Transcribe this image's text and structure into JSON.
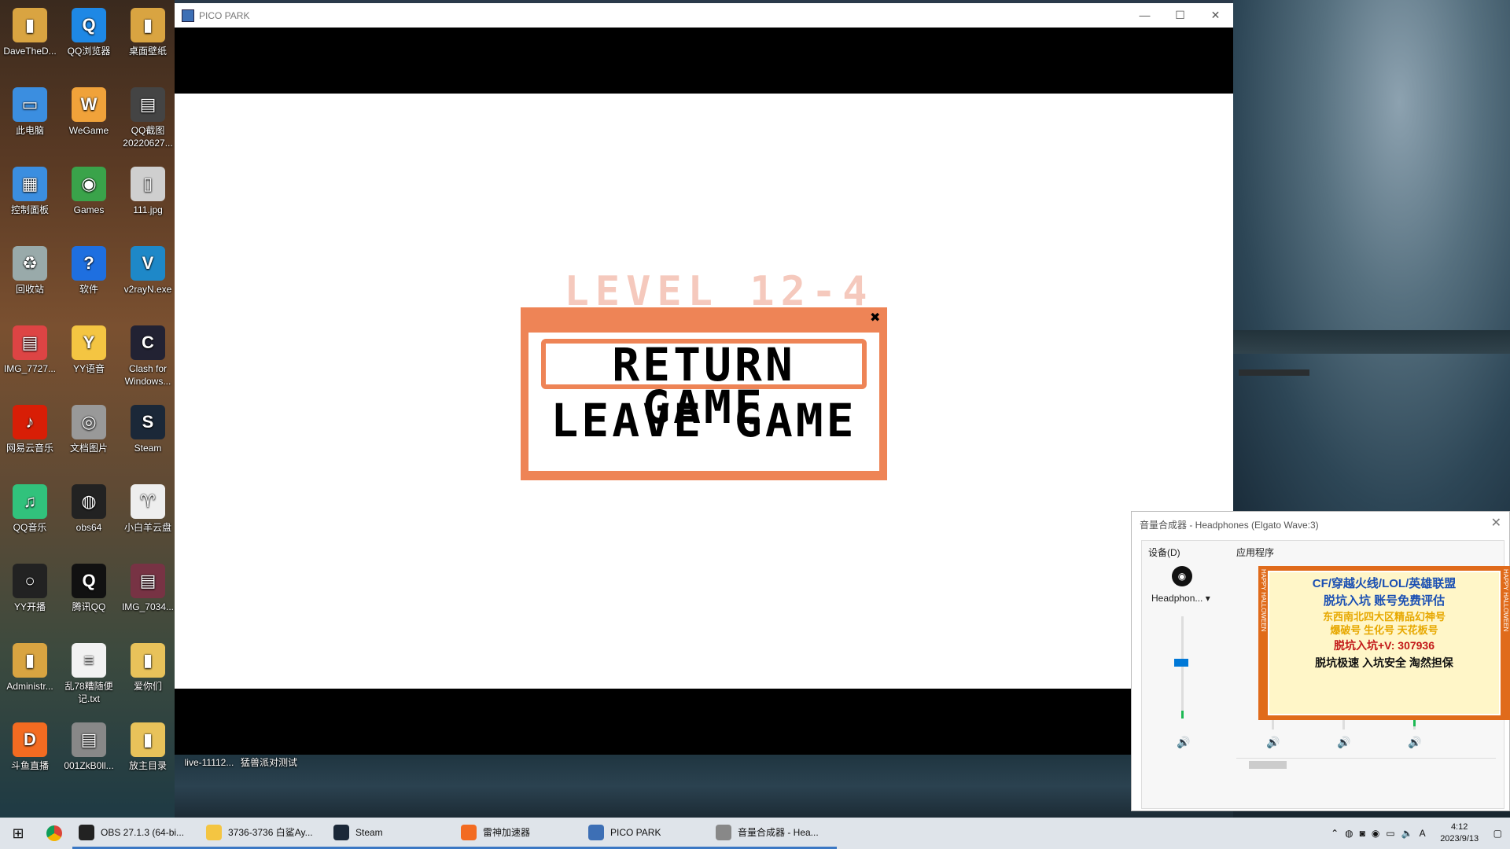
{
  "desktop_icons": [
    {
      "label": "DaveTheD...",
      "icon": "folder-icon",
      "color": "#d9a441",
      "glyph": "▮"
    },
    {
      "label": "QQ浏览器",
      "icon": "qq-browser-icon",
      "color": "#1e88e5",
      "glyph": "Q"
    },
    {
      "label": "桌面壁纸",
      "icon": "folder-icon",
      "color": "#d9a441",
      "glyph": "▮"
    },
    {
      "label": "此电脑",
      "icon": "computer-icon",
      "color": "#3b8ee0",
      "glyph": "▭"
    },
    {
      "label": "WeGame",
      "icon": "wegame-icon",
      "color": "#f0a23a",
      "glyph": "W"
    },
    {
      "label": "QQ截图\n20220627...",
      "icon": "image-file-icon",
      "color": "#444",
      "glyph": "▤"
    },
    {
      "label": "控制面板",
      "icon": "control-panel-icon",
      "color": "#3b8ee0",
      "glyph": "▦"
    },
    {
      "label": "Games",
      "icon": "games-icon",
      "color": "#3aa34a",
      "glyph": "◉"
    },
    {
      "label": "111.jpg",
      "icon": "image-file-icon",
      "color": "#cfcfcf",
      "glyph": "▯"
    },
    {
      "label": "回收站",
      "icon": "recycle-bin-icon",
      "color": "#9aa",
      "glyph": "♻"
    },
    {
      "label": "软件",
      "icon": "help-icon",
      "color": "#1e6fe0",
      "glyph": "?"
    },
    {
      "label": "v2rayN.exe",
      "icon": "v2ray-icon",
      "color": "#1e88c8",
      "glyph": "V"
    },
    {
      "label": "IMG_7727...",
      "icon": "image-file-icon",
      "color": "#d44",
      "glyph": "▤"
    },
    {
      "label": "YY语音",
      "icon": "yy-icon",
      "color": "#f4c542",
      "glyph": "Y"
    },
    {
      "label": "Clash for\nWindows...",
      "icon": "clash-icon",
      "color": "#223",
      "glyph": "C"
    },
    {
      "label": "网易云音乐",
      "icon": "netease-music-icon",
      "color": "#d81e06",
      "glyph": "♪"
    },
    {
      "label": "文档图片",
      "icon": "camera-icon",
      "color": "#999",
      "glyph": "◎"
    },
    {
      "label": "Steam",
      "icon": "steam-icon",
      "color": "#1b2838",
      "glyph": "S"
    },
    {
      "label": "QQ音乐",
      "icon": "qq-music-icon",
      "color": "#31c27c",
      "glyph": "♫"
    },
    {
      "label": "obs64",
      "icon": "obs-icon",
      "color": "#222",
      "glyph": "◍"
    },
    {
      "label": "小白羊云盘",
      "icon": "sheep-icon",
      "color": "#eee",
      "glyph": "♈"
    },
    {
      "label": "YY开播",
      "icon": "yy-live-icon",
      "color": "#222",
      "glyph": "○"
    },
    {
      "label": "腾讯QQ",
      "icon": "qq-icon",
      "color": "#111",
      "glyph": "Q"
    },
    {
      "label": "IMG_7034...",
      "icon": "image-file-icon",
      "color": "#734",
      "glyph": "▤"
    },
    {
      "label": "Administr...",
      "icon": "user-folder-icon",
      "color": "#d9a441",
      "glyph": "▮"
    },
    {
      "label": "乱78糟随便\n记.txt",
      "icon": "text-file-icon",
      "color": "#f2f2f2",
      "glyph": "≡"
    },
    {
      "label": "爱你们",
      "icon": "folder-icon",
      "color": "#e8c25a",
      "glyph": "▮"
    },
    {
      "label": "斗鱼直播",
      "icon": "douyu-icon",
      "color": "#f36b21",
      "glyph": "D"
    },
    {
      "label": "001ZkB0ll...",
      "icon": "image-file-icon",
      "color": "#888",
      "glyph": "▤"
    },
    {
      "label": "放主目录",
      "icon": "folder-icon",
      "color": "#e8c25a",
      "glyph": "▮"
    }
  ],
  "extra_desktop_labels": [
    "live-11112...",
    "猛兽派对测试"
  ],
  "game_window": {
    "title": "PICO PARK",
    "level": "LEVEL 12-4",
    "menu": {
      "return": "RETURN GAME",
      "leave": "LEAVE GAME",
      "close_glyph": "✖"
    }
  },
  "mixer": {
    "title": "音量合成器 - Headphones (Elgato Wave:3)",
    "device_label": "设备(D)",
    "apps_label": "应用程序",
    "device_name": "Headphon... ▾",
    "device_level": 0.5,
    "speaker_glyph": "🔊"
  },
  "ad": {
    "line1": "CF/穿越火线/LOL/英雄联盟",
    "line2": "脱坑入坑 账号免费评估",
    "line3": "东西南北四大区精品幻神号",
    "line4": "爆破号 生化号 天花板号",
    "line5": "脱坑入坑+V: 307936",
    "line6": "脱坑极速 入坑安全 淘然担保",
    "side": "HAPPY HALLOWEEN"
  },
  "taskbar": {
    "items": [
      {
        "label": "OBS 27.1.3 (64-bi...",
        "icon": "obs-icon",
        "color": "#222",
        "active": true
      },
      {
        "label": "3736-3736 白鲨Ay...",
        "icon": "yy-icon",
        "color": "#f4c542",
        "active": true
      },
      {
        "label": "Steam",
        "icon": "steam-icon",
        "color": "#1b2838",
        "active": true
      },
      {
        "label": "雷神加速器",
        "icon": "leishen-icon",
        "color": "#f36b21",
        "active": true
      },
      {
        "label": "PICO PARK",
        "icon": "pico-park-icon",
        "color": "#3d6fb5",
        "active": true
      },
      {
        "label": "音量合成器 - Hea...",
        "icon": "volume-mixer-icon",
        "color": "#888",
        "active": true
      }
    ],
    "time": "4:12",
    "date": "2023/9/13"
  }
}
